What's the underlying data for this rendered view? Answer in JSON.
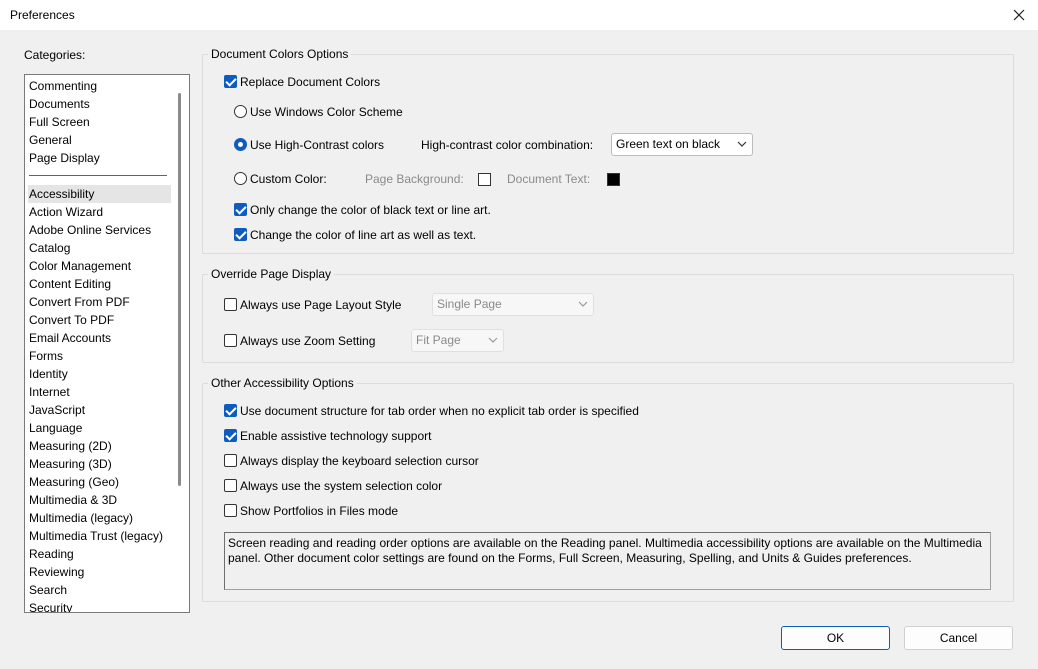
{
  "window": {
    "title": "Preferences"
  },
  "categories": {
    "label": "Categories:",
    "top_items": [
      "Commenting",
      "Documents",
      "Full Screen",
      "General",
      "Page Display"
    ],
    "items": [
      "Accessibility",
      "Action Wizard",
      "Adobe Online Services",
      "Catalog",
      "Color Management",
      "Content Editing",
      "Convert From PDF",
      "Convert To PDF",
      "Email Accounts",
      "Forms",
      "Identity",
      "Internet",
      "JavaScript",
      "Language",
      "Measuring (2D)",
      "Measuring (3D)",
      "Measuring (Geo)",
      "Multimedia & 3D",
      "Multimedia (legacy)",
      "Multimedia Trust (legacy)",
      "Reading",
      "Reviewing",
      "Search",
      "Security"
    ],
    "selected": "Accessibility"
  },
  "doc_colors": {
    "title": "Document Colors Options",
    "replace_label": "Replace Document Colors",
    "replace_checked": true,
    "windows_scheme_label": "Use Windows Color Scheme",
    "high_contrast_label": "Use High-Contrast colors",
    "combination_label": "High-contrast color combination:",
    "combination_value": "Green text on black",
    "custom_label": "Custom Color:",
    "page_bg_label": "Page Background:",
    "page_bg_color": "#ffffff",
    "doc_text_label": "Document Text:",
    "doc_text_color": "#000000",
    "only_black_label": "Only change the color of black text or line art.",
    "only_black_checked": true,
    "line_art_label": "Change the color of line art as well as text.",
    "line_art_checked": true,
    "selected_radio": "high_contrast"
  },
  "override": {
    "title": "Override Page Display",
    "layout_label": "Always use Page Layout Style",
    "layout_checked": false,
    "layout_value": "Single Page",
    "zoom_label": "Always use Zoom Setting",
    "zoom_checked": false,
    "zoom_value": "Fit Page"
  },
  "other": {
    "title": "Other Accessibility Options",
    "tab_order_label": "Use document structure for tab order when no explicit tab order is specified",
    "tab_order_checked": true,
    "assistive_label": "Enable assistive technology support",
    "assistive_checked": true,
    "cursor_label": "Always display the keyboard selection cursor",
    "cursor_checked": false,
    "system_color_label": "Always use the system selection color",
    "system_color_checked": false,
    "portfolios_label": "Show Portfolios in Files mode",
    "portfolios_checked": false,
    "info_text": "Screen reading and reading order options are available on the Reading panel. Multimedia accessibility options are available on the Multimedia panel. Other document color settings are found on the Forms, Full Screen, Measuring, Spelling, and Units & Guides preferences."
  },
  "buttons": {
    "ok": "OK",
    "cancel": "Cancel"
  },
  "colors": {
    "accent": "#0f5cbf",
    "separator": "#2c6fbf"
  }
}
